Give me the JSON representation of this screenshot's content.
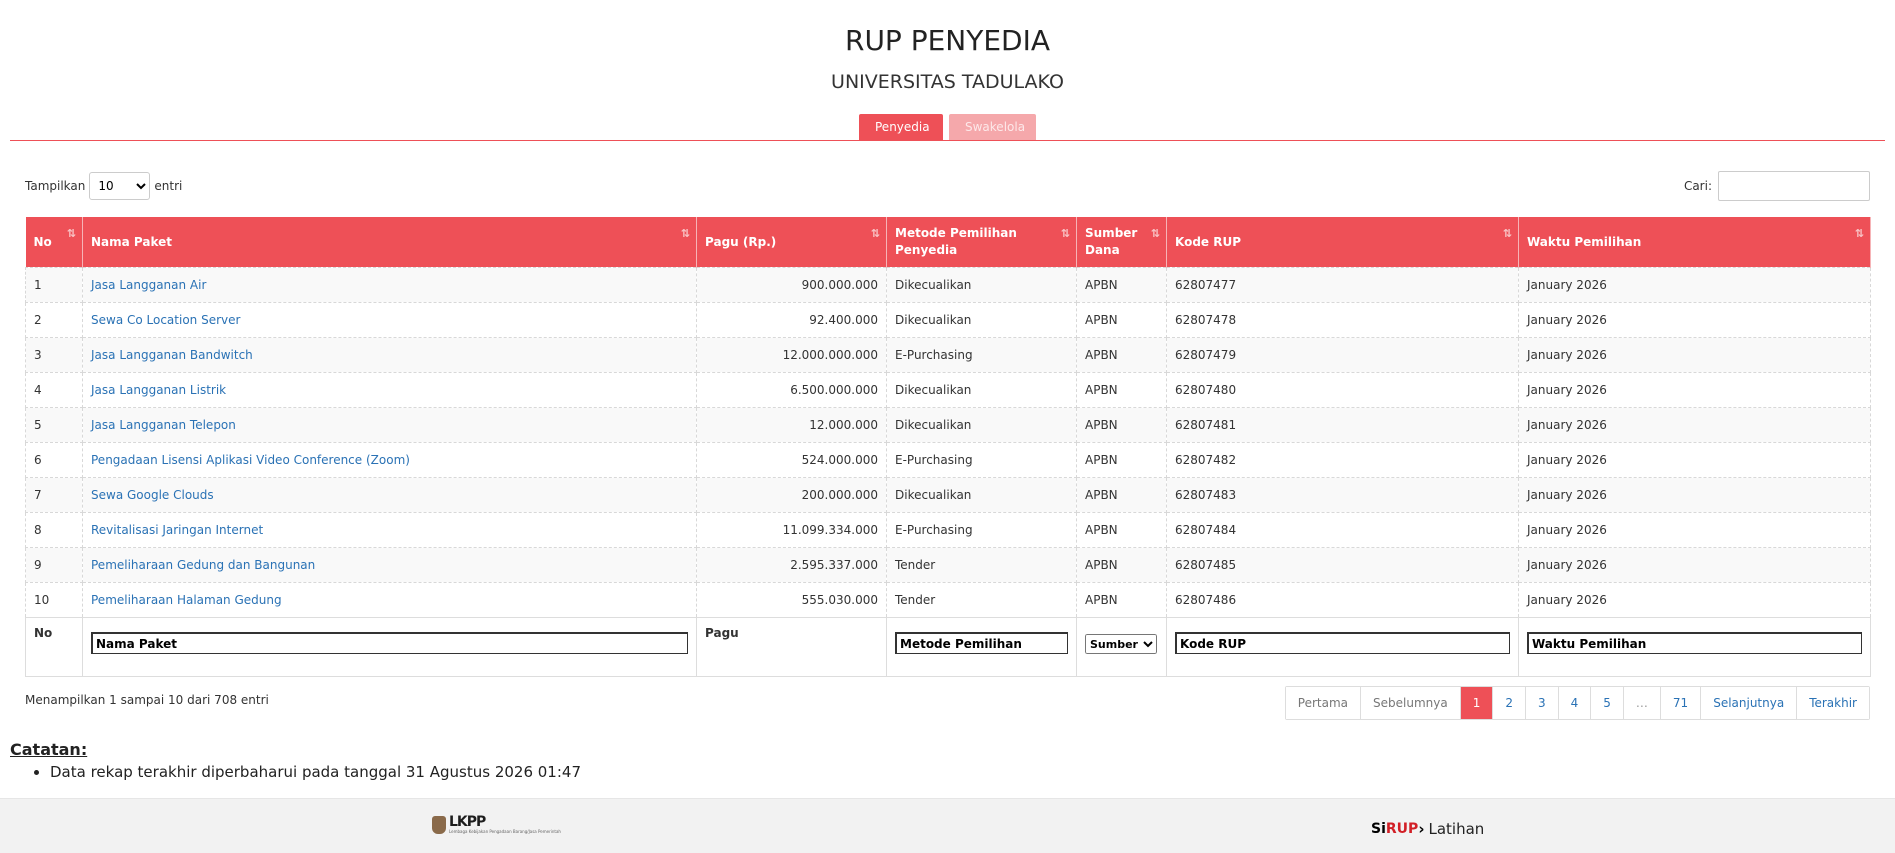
{
  "header": {
    "title": "RUP PENYEDIA",
    "subtitle": "UNIVERSITAS TADULAKO"
  },
  "tabs": [
    {
      "label": "Penyedia",
      "active": true
    },
    {
      "label": "Swakelola",
      "active": false
    }
  ],
  "controls": {
    "length_prefix": "Tampilkan",
    "length_value": "10",
    "length_suffix": "entri",
    "search_label": "Cari:",
    "search_value": ""
  },
  "table": {
    "headers": {
      "no": "No",
      "nama": "Nama Paket",
      "pagu": "Pagu (Rp.)",
      "metode": "Metode Pemilihan Penyedia",
      "sumber": "Sumber Dana",
      "kode": "Kode RUP",
      "waktu": "Waktu Pemilihan"
    },
    "rows": [
      {
        "no": "1",
        "nama": "Jasa Langganan Air",
        "pagu": "900.000.000",
        "metode": "Dikecualikan",
        "sumber": "APBN",
        "kode": "62807477",
        "waktu": "January 2026"
      },
      {
        "no": "2",
        "nama": "Sewa Co Location Server",
        "pagu": "92.400.000",
        "metode": "Dikecualikan",
        "sumber": "APBN",
        "kode": "62807478",
        "waktu": "January 2026"
      },
      {
        "no": "3",
        "nama": "Jasa Langganan Bandwitch",
        "pagu": "12.000.000.000",
        "metode": "E-Purchasing",
        "sumber": "APBN",
        "kode": "62807479",
        "waktu": "January 2026"
      },
      {
        "no": "4",
        "nama": "Jasa Langganan Listrik",
        "pagu": "6.500.000.000",
        "metode": "Dikecualikan",
        "sumber": "APBN",
        "kode": "62807480",
        "waktu": "January 2026"
      },
      {
        "no": "5",
        "nama": "Jasa Langganan Telepon",
        "pagu": "12.000.000",
        "metode": "Dikecualikan",
        "sumber": "APBN",
        "kode": "62807481",
        "waktu": "January 2026"
      },
      {
        "no": "6",
        "nama": "Pengadaan Lisensi Aplikasi Video Conference (Zoom)",
        "pagu": "524.000.000",
        "metode": "E-Purchasing",
        "sumber": "APBN",
        "kode": "62807482",
        "waktu": "January 2026"
      },
      {
        "no": "7",
        "nama": "Sewa Google Clouds",
        "pagu": "200.000.000",
        "metode": "Dikecualikan",
        "sumber": "APBN",
        "kode": "62807483",
        "waktu": "January 2026"
      },
      {
        "no": "8",
        "nama": "Revitalisasi Jaringan Internet",
        "pagu": "11.099.334.000",
        "metode": "E-Purchasing",
        "sumber": "APBN",
        "kode": "62807484",
        "waktu": "January 2026"
      },
      {
        "no": "9",
        "nama": "Pemeliharaan Gedung dan Bangunan",
        "pagu": "2.595.337.000",
        "metode": "Tender",
        "sumber": "APBN",
        "kode": "62807485",
        "waktu": "January 2026"
      },
      {
        "no": "10",
        "nama": "Pemeliharaan Halaman Gedung",
        "pagu": "555.030.000",
        "metode": "Tender",
        "sumber": "APBN",
        "kode": "62807486",
        "waktu": "January 2026"
      }
    ],
    "footer": {
      "no": "No",
      "nama_filter": "Nama Paket",
      "pagu": "Pagu",
      "metode_filter": "Metode Pemilihan",
      "sumber_filter": "Sumber Dana",
      "kode_filter": "Kode RUP",
      "waktu_filter": "Waktu Pemilihan"
    }
  },
  "info": "Menampilkan 1 sampai 10 dari 708 entri",
  "pagination": {
    "first": "Pertama",
    "prev": "Sebelumnya",
    "pages": [
      "1",
      "2",
      "3",
      "4",
      "5"
    ],
    "ellipsis": "…",
    "last_page": "71",
    "next": "Selanjutnya",
    "last": "Terakhir",
    "current": "1"
  },
  "notes": {
    "title": "Catatan:",
    "items": [
      "Data rekap terakhir diperbaharui pada tanggal 31 Agustus 2026 01:47"
    ]
  },
  "footer": {
    "lkpp_logo": "LKPP",
    "lkpp_sub": "Lembaga Kebijakan Pengadaan Barang/Jasa Pemerintah",
    "sirup_si": "Si",
    "sirup_rup": "RUP",
    "sirup_suffix": "Latihan"
  },
  "colors": {
    "accent": "#ee5057",
    "accent_light": "#f5a8ab",
    "link": "#2a72b5"
  },
  "icons": [
    "sort-icon",
    "chevron-down-icon",
    "garuda-emblem-icon",
    "arrow-icon"
  ]
}
